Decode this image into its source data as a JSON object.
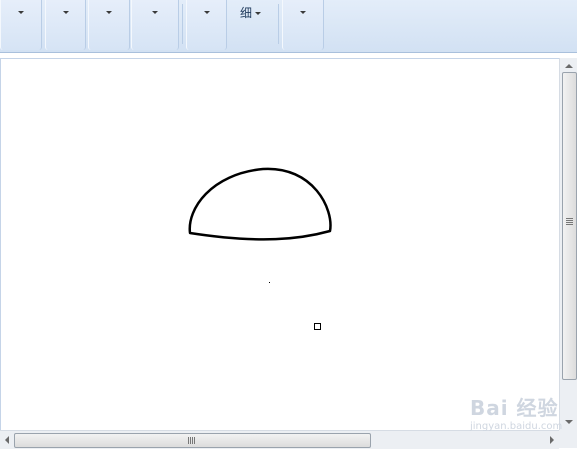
{
  "ribbon": {
    "groups": [
      {
        "label": "",
        "name": "group-1"
      },
      {
        "label": "",
        "name": "group-2"
      },
      {
        "label": "",
        "name": "group-3"
      },
      {
        "label": "",
        "name": "group-4"
      },
      {
        "label": "",
        "name": "group-5"
      },
      {
        "label": "细",
        "name": "group-6-detail"
      },
      {
        "label": "",
        "name": "group-7"
      }
    ]
  },
  "canvas": {
    "background": "#ffffff",
    "shapes": [
      "semicircle-outline",
      "dot",
      "small-square-handle"
    ]
  },
  "watermark": {
    "main": "Bai 经验",
    "sub": "jingyan.baidu.com"
  },
  "colors": {
    "ribbon_bg": "#d9e6f5",
    "stroke": "#000000"
  }
}
